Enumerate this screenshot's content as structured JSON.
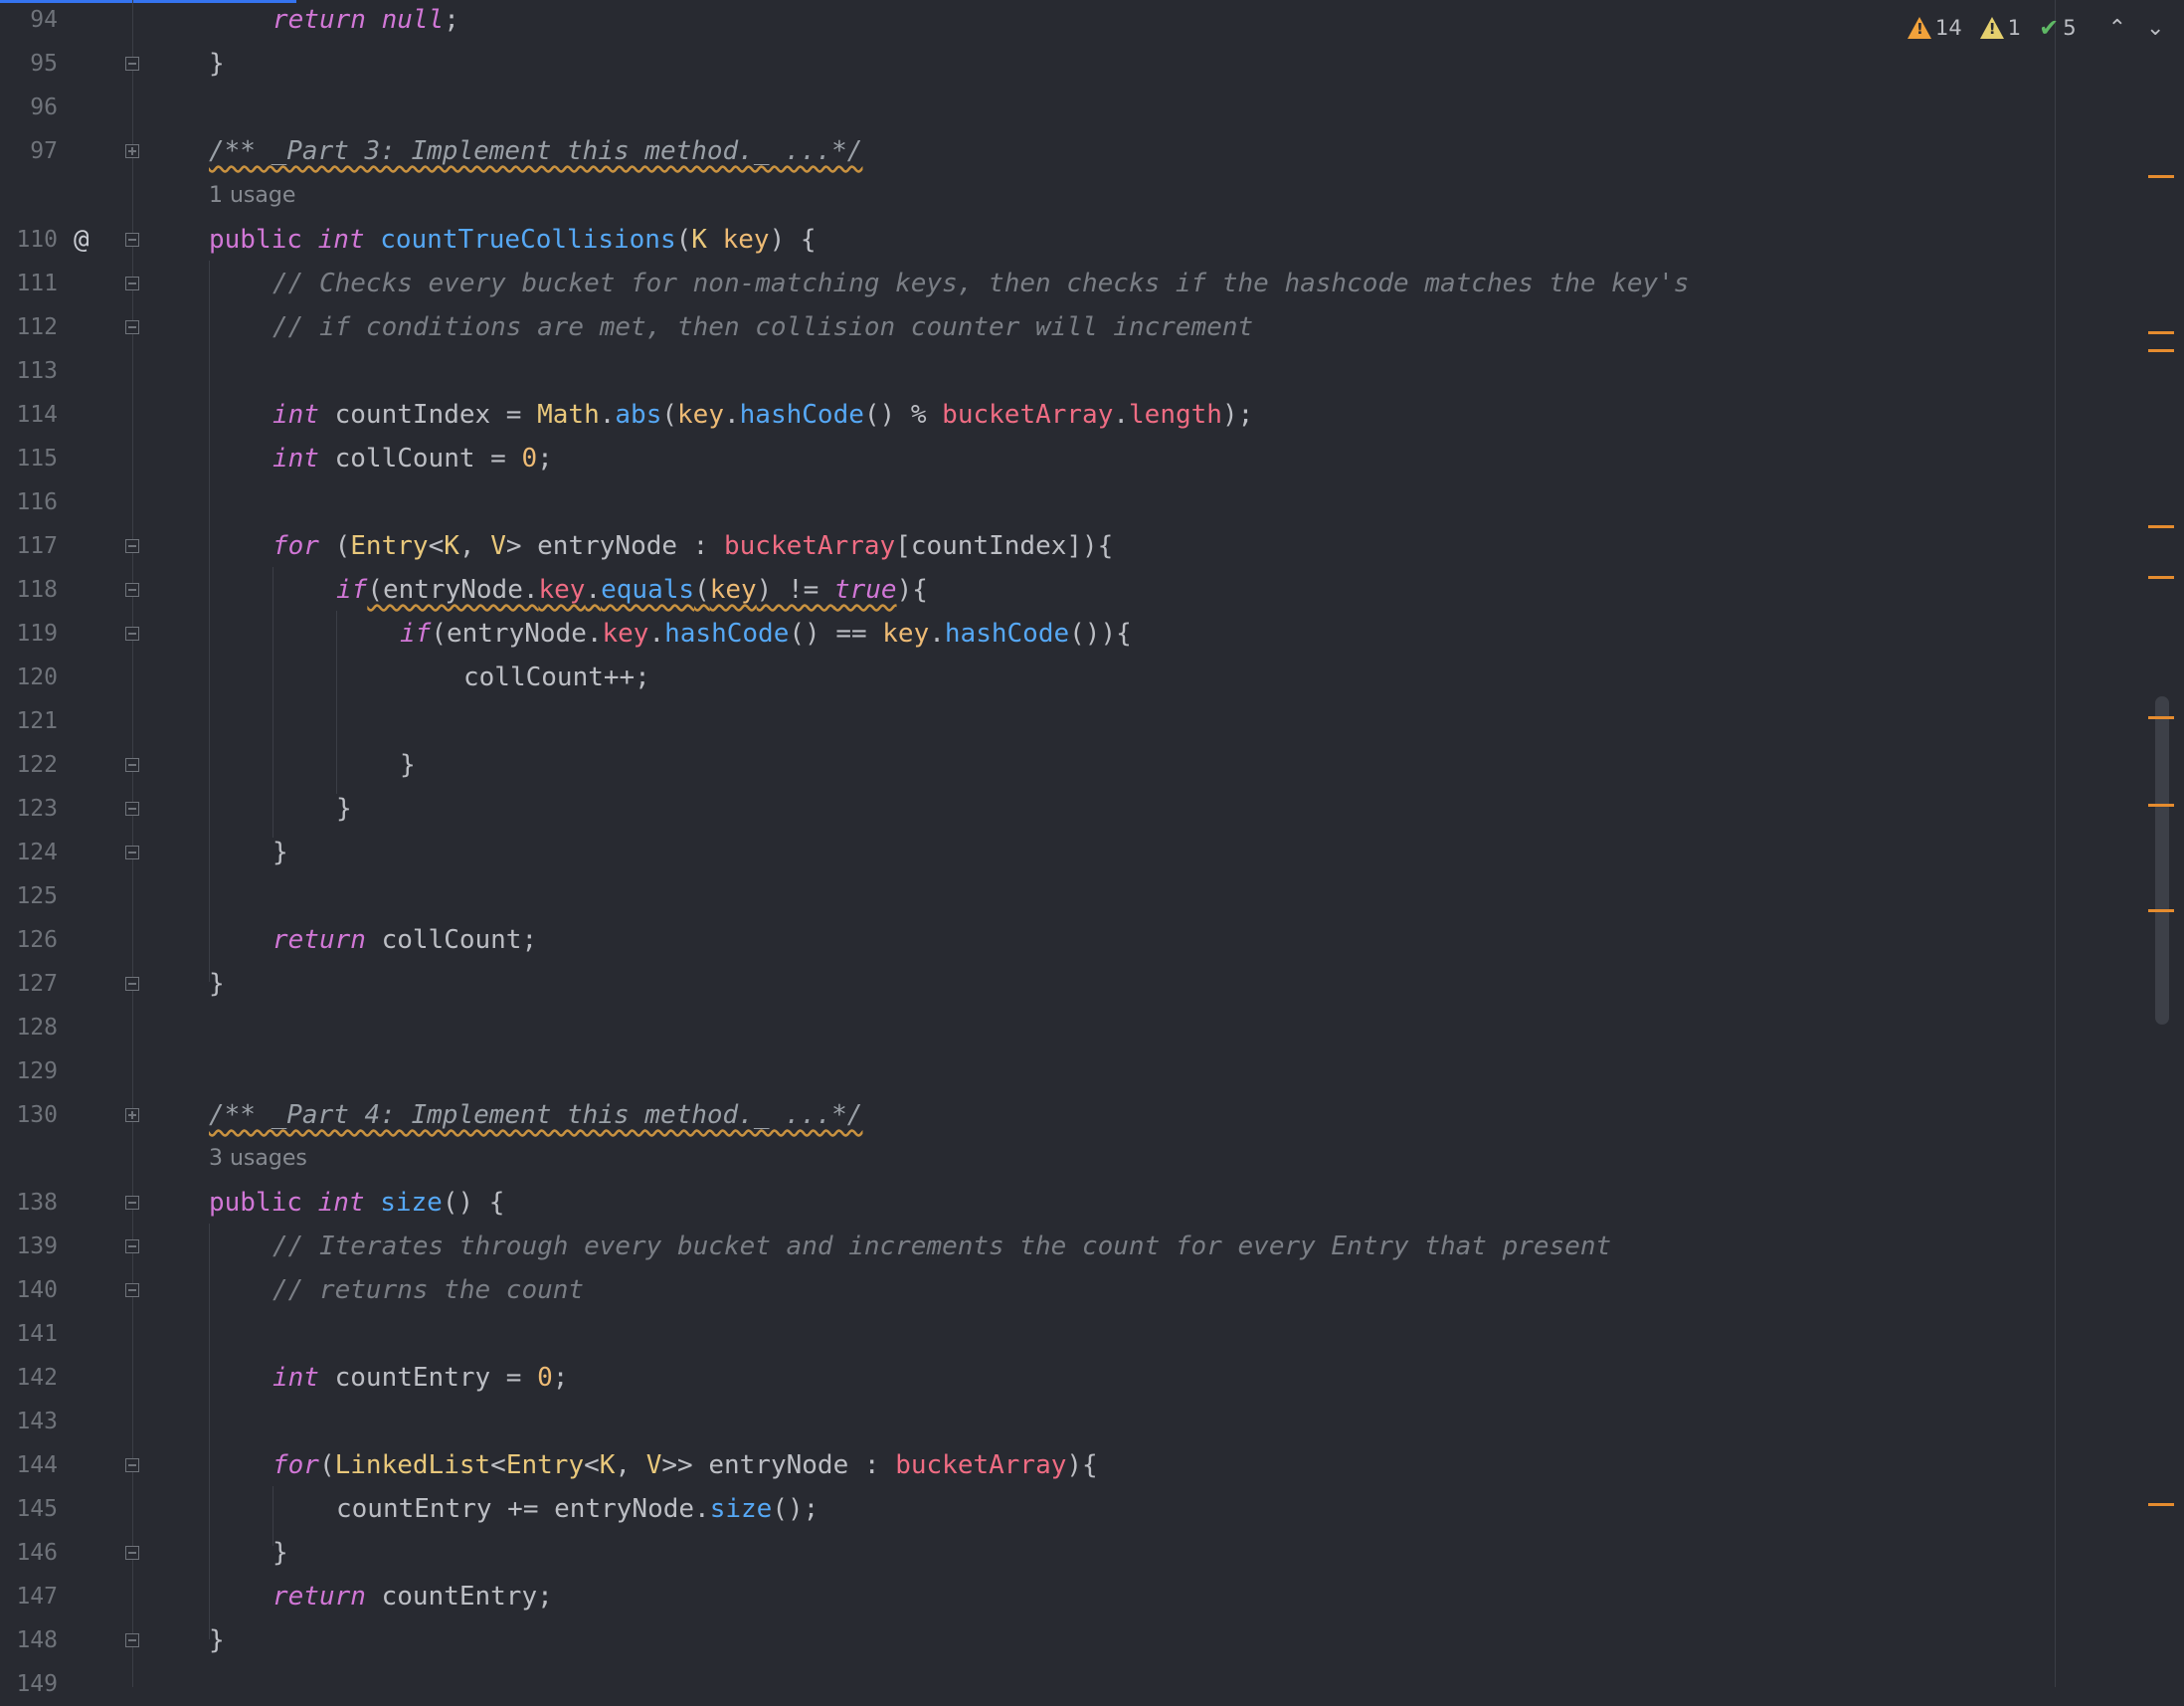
{
  "status": {
    "warnings_count": "14",
    "weak_warnings_count": "1",
    "typos_count": "5",
    "warning_icon": "warning-triangle-icon",
    "weak_warning_icon": "weak-warning-triangle-icon",
    "typo_icon": "check-icon",
    "prev_icon": "chevron-up-icon",
    "next_icon": "chevron-down-icon",
    "prev_glyph": "⌃",
    "next_glyph": "⌄"
  },
  "gutter": {
    "implements_glyph": "@"
  },
  "lines": {
    "n94": "94",
    "n95": "95",
    "n96": "96",
    "n97": "97",
    "n110": "110",
    "n111": "111",
    "n112": "112",
    "n113": "113",
    "n114": "114",
    "n115": "115",
    "n116": "116",
    "n117": "117",
    "n118": "118",
    "n119": "119",
    "n120": "120",
    "n121": "121",
    "n122": "122",
    "n123": "123",
    "n124": "124",
    "n125": "125",
    "n126": "126",
    "n127": "127",
    "n128": "128",
    "n129": "129",
    "n130": "130",
    "n138": "138",
    "n139": "139",
    "n140": "140",
    "n141": "141",
    "n142": "142",
    "n143": "143",
    "n144": "144",
    "n145": "145",
    "n146": "146",
    "n147": "147",
    "n148": "148",
    "n149": "149"
  },
  "code": {
    "l94_kw": "return",
    "l94_null": "null",
    "l94_semi": ";",
    "l95": "}",
    "l97": "/** _Part 3: Implement this method._ ...*/",
    "usage1": "1 usage",
    "l110_public": "public",
    "l110_int": "int",
    "l110_name": "countTrueCollisions",
    "l110_open": "(",
    "l110_K": "K",
    "l110_key": "key",
    "l110_close": ") {",
    "l111": "// Checks every bucket for non-matching keys, then checks if the hashcode matches the key's",
    "l112": "// if conditions are met, then collision counter will increment",
    "l114_int": "int",
    "l114_var": "countIndex = ",
    "l114_math": "Math",
    "l114_dot1": ".",
    "l114_abs": "abs",
    "l114_p1": "(",
    "l114_key": "key",
    "l114_dot2": ".",
    "l114_hash": "hashCode",
    "l114_mid": "() % ",
    "l114_bucket": "bucketArray",
    "l114_dot3": ".",
    "l114_len": "length",
    "l114_end": ");",
    "l115_int": "int",
    "l115_rest1": "collCount = ",
    "l115_zero": "0",
    "l115_semi": ";",
    "l117_for": "for",
    "l117_p": " (",
    "l117_entry": "Entry",
    "l117_lt": "<",
    "l117_K": "K",
    "l117_comma": ", ",
    "l117_V": "V",
    "l117_gt": "> entryNode : ",
    "l117_bucket": "bucketArray",
    "l117_end": "[countIndex]){",
    "l118_if": "if",
    "l118_a": "(entryNode.",
    "l118_key": "key",
    "l118_dot": ".",
    "l118_equals": "equals",
    "l118_p": "(",
    "l118_keyarg": "key",
    "l118_ne": ") != ",
    "l118_true": "true",
    "l118_end": "){",
    "l119_if": "if",
    "l119_a": "(entryNode.",
    "l119_key": "key",
    "l119_dot": ".",
    "l119_hash": "hashCode",
    "l119_eq": "() == ",
    "l119_key2": "key",
    "l119_dot2": ".",
    "l119_hash2": "hashCode",
    "l119_end": "()){",
    "l120": "collCount++;",
    "l122": "}",
    "l123": "}",
    "l124": "}",
    "l126_kw": "return",
    "l126_rest": " collCount;",
    "l127": "}",
    "l130": "/** _Part 4: Implement this method._ ...*/",
    "usage3": "3 usages",
    "l138_public": "public",
    "l138_int": "int",
    "l138_name": "size",
    "l138_rest": "() {",
    "l139": "// Iterates through every bucket and increments the count for every Entry that present",
    "l140": "// returns the count",
    "l142_int": "int",
    "l142_rest1": "countEntry = ",
    "l142_zero": "0",
    "l142_semi": ";",
    "l144_for": "for",
    "l144_p": "(",
    "l144_ll": "LinkedList",
    "l144_lt": "<",
    "l144_entry": "Entry",
    "l144_lt2": "<",
    "l144_K": "K",
    "l144_comma": ", ",
    "l144_V": "V",
    "l144_gt": ">> entryNode : ",
    "l144_bucket": "bucketArray",
    "l144_end": "){",
    "l145_a": "countEntry += entryNode.",
    "l145_size": "size",
    "l145_end": "();",
    "l146": "}",
    "l147_kw": "return",
    "l147_rest": " countEntry;",
    "l148": "}"
  },
  "colors": {
    "background": "#282a31",
    "keyword": "#d177d6",
    "comment": "#7a7e85",
    "function": "#56a8f5",
    "field": "#ef6c83",
    "type": "#e9c87b",
    "number": "#eebb75",
    "warning_marker": "#e58c2f"
  }
}
